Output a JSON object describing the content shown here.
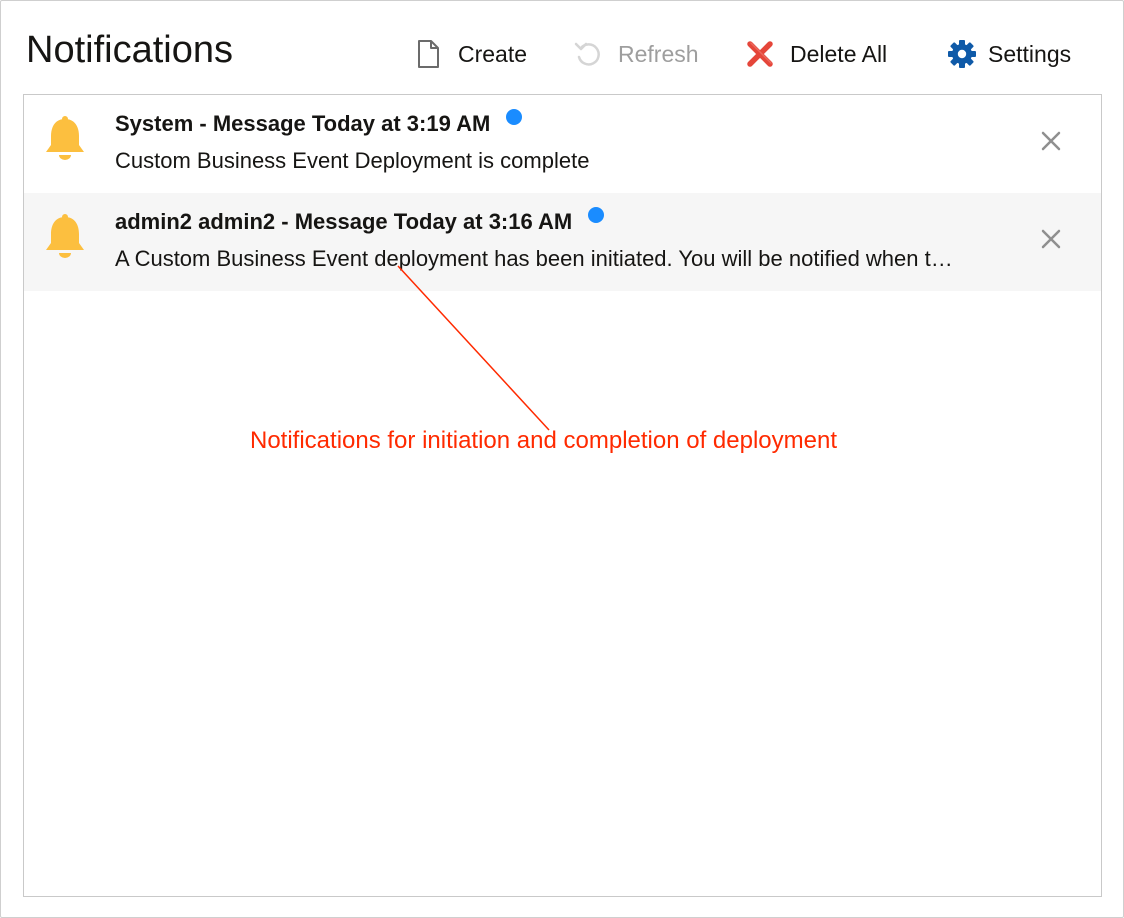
{
  "header": {
    "title": "Notifications"
  },
  "toolbar": {
    "create_label": "Create",
    "refresh_label": "Refresh",
    "delete_all_label": "Delete All",
    "settings_label": "Settings"
  },
  "notifications": [
    {
      "title": "System - Message Today at 3:19 AM",
      "body": "Custom Business Event Deployment is complete",
      "unread": true
    },
    {
      "title": "admin2 admin2 - Message Today at 3:16 AM",
      "body": "A Custom Business Event deployment has been initiated. You will be notified when the deployment is complete.",
      "unread": true
    }
  ],
  "annotation": {
    "text": "Notifications for initiation and completion of deployment"
  },
  "colors": {
    "bell": "#fcbf3f",
    "unread_dot": "#1a8cff",
    "delete_icon": "#e5463a",
    "settings_icon": "#0f5aa8",
    "annotation": "#ff2a00"
  },
  "icons": {
    "create": "document-icon",
    "refresh": "refresh-icon",
    "delete_all": "red-x-icon",
    "settings": "gear-icon",
    "notification": "bell-icon",
    "dismiss": "close-icon"
  }
}
